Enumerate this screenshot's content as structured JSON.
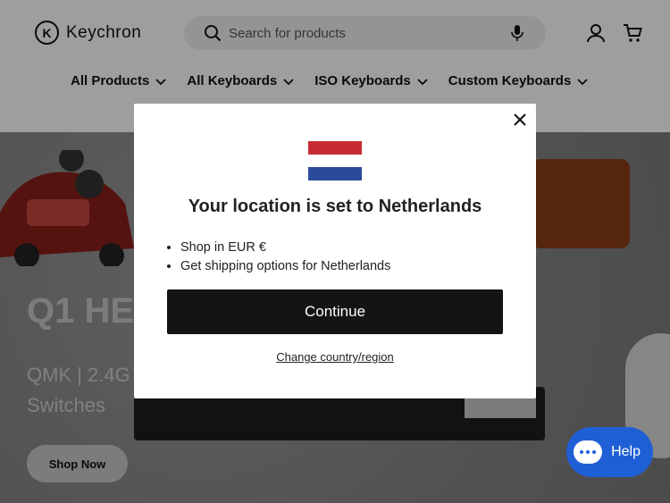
{
  "header": {
    "logo_mark": "K",
    "logo_text": "Keychron",
    "search_placeholder": "Search for products",
    "nav": [
      {
        "label": "All Products"
      },
      {
        "label": "All Keyboards"
      },
      {
        "label": "ISO Keyboards"
      },
      {
        "label": "Custom Keyboards"
      }
    ]
  },
  "hero": {
    "title": "Q1 HE",
    "subtitle": "QMK | 2.4G Switches",
    "shop_now": "Shop Now"
  },
  "modal": {
    "title": "Your location is set to Netherlands",
    "bullets": [
      "Shop in EUR €",
      "Get shipping options for Netherlands"
    ],
    "continue": "Continue",
    "change_link": "Change country/region",
    "flag_colors": [
      "#c72b31",
      "#ffffff",
      "#2a4b9b"
    ]
  },
  "help": {
    "label": "Help"
  },
  "colors": {
    "accent": "#1f5fd6",
    "button_dark": "#141414"
  }
}
